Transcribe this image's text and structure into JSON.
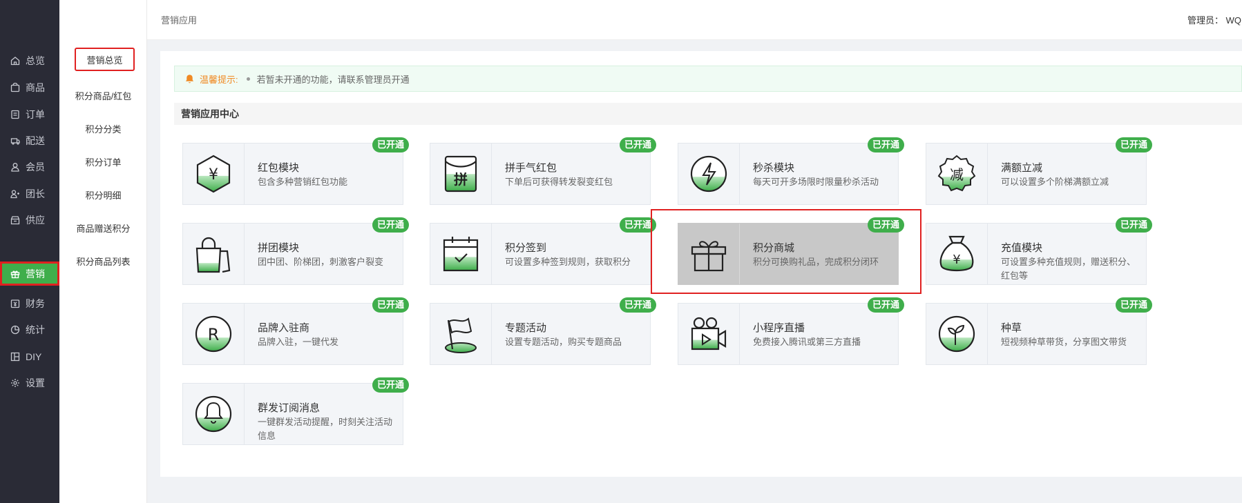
{
  "sidebar": {
    "items": [
      {
        "label": "总览",
        "icon": "home-icon"
      },
      {
        "label": "商品",
        "icon": "goods-icon"
      },
      {
        "label": "订单",
        "icon": "order-icon"
      },
      {
        "label": "配送",
        "icon": "delivery-icon"
      },
      {
        "label": "会员",
        "icon": "member-icon"
      },
      {
        "label": "团长",
        "icon": "leader-icon"
      },
      {
        "label": "供应",
        "icon": "supply-icon"
      },
      {
        "label": "营销",
        "icon": "gift-icon",
        "active": true
      },
      {
        "label": "财务",
        "icon": "finance-icon"
      },
      {
        "label": "统计",
        "icon": "chart-icon"
      },
      {
        "label": "DIY",
        "icon": "diy-icon"
      },
      {
        "label": "设置",
        "icon": "settings-icon"
      }
    ]
  },
  "subnav": {
    "items": [
      "营销总览",
      "积分商品/红包",
      "积分分类",
      "积分订单",
      "积分明细",
      "商品赠送积分",
      "积分商品列表"
    ]
  },
  "header": {
    "breadcrumb": "营销应用",
    "admin": "管理员： WQ"
  },
  "tip": {
    "title": "温馨提示:",
    "text": "若暂未开通的功能，请联系管理员开通"
  },
  "section_title": "营销应用中心",
  "colors": {
    "brand_green": "#3fae4b",
    "sidebar_bg": "#2a2b36",
    "highlight_red": "#e02020",
    "tip_orange": "#f08a24"
  },
  "badge_label": "已开通",
  "cards": [
    {
      "title": "红包模块",
      "desc": "包含多种营销红包功能",
      "icon": "red-packet-icon"
    },
    {
      "title": "拼手气红包",
      "desc": "下单后可获得转发裂变红包",
      "icon": "lucky-packet-icon"
    },
    {
      "title": "秒杀模块",
      "desc": "每天可开多场限时限量秒杀活动",
      "icon": "flash-sale-icon"
    },
    {
      "title": "满额立减",
      "desc": "可以设置多个阶梯满额立减",
      "icon": "discount-icon"
    },
    {
      "title": "拼团模块",
      "desc": "团中团、阶梯团，刺激客户裂变",
      "icon": "group-buy-icon"
    },
    {
      "title": "积分签到",
      "desc": "可设置多种签到规则，获取积分",
      "icon": "sign-in-icon"
    },
    {
      "title": "积分商城",
      "desc": "积分可换购礼品，完成积分闭环",
      "icon": "points-mall-icon",
      "highlighted": true
    },
    {
      "title": "充值模块",
      "desc": "可设置多种充值规则，赠送积分、红包等",
      "icon": "recharge-icon"
    },
    {
      "title": "品牌入驻商",
      "desc": "品牌入驻，一键代发",
      "icon": "brand-icon"
    },
    {
      "title": "专题活动",
      "desc": "设置专题活动，购买专题商品",
      "icon": "topic-icon"
    },
    {
      "title": "小程序直播",
      "desc": "免费接入腾讯或第三方直播",
      "icon": "live-icon"
    },
    {
      "title": "种草",
      "desc": "短视频种草带货，分享图文带货",
      "icon": "seeding-icon"
    },
    {
      "title": "群发订阅消息",
      "desc": "一键群发活动提醒，时刻关注活动信息",
      "icon": "message-icon"
    }
  ]
}
